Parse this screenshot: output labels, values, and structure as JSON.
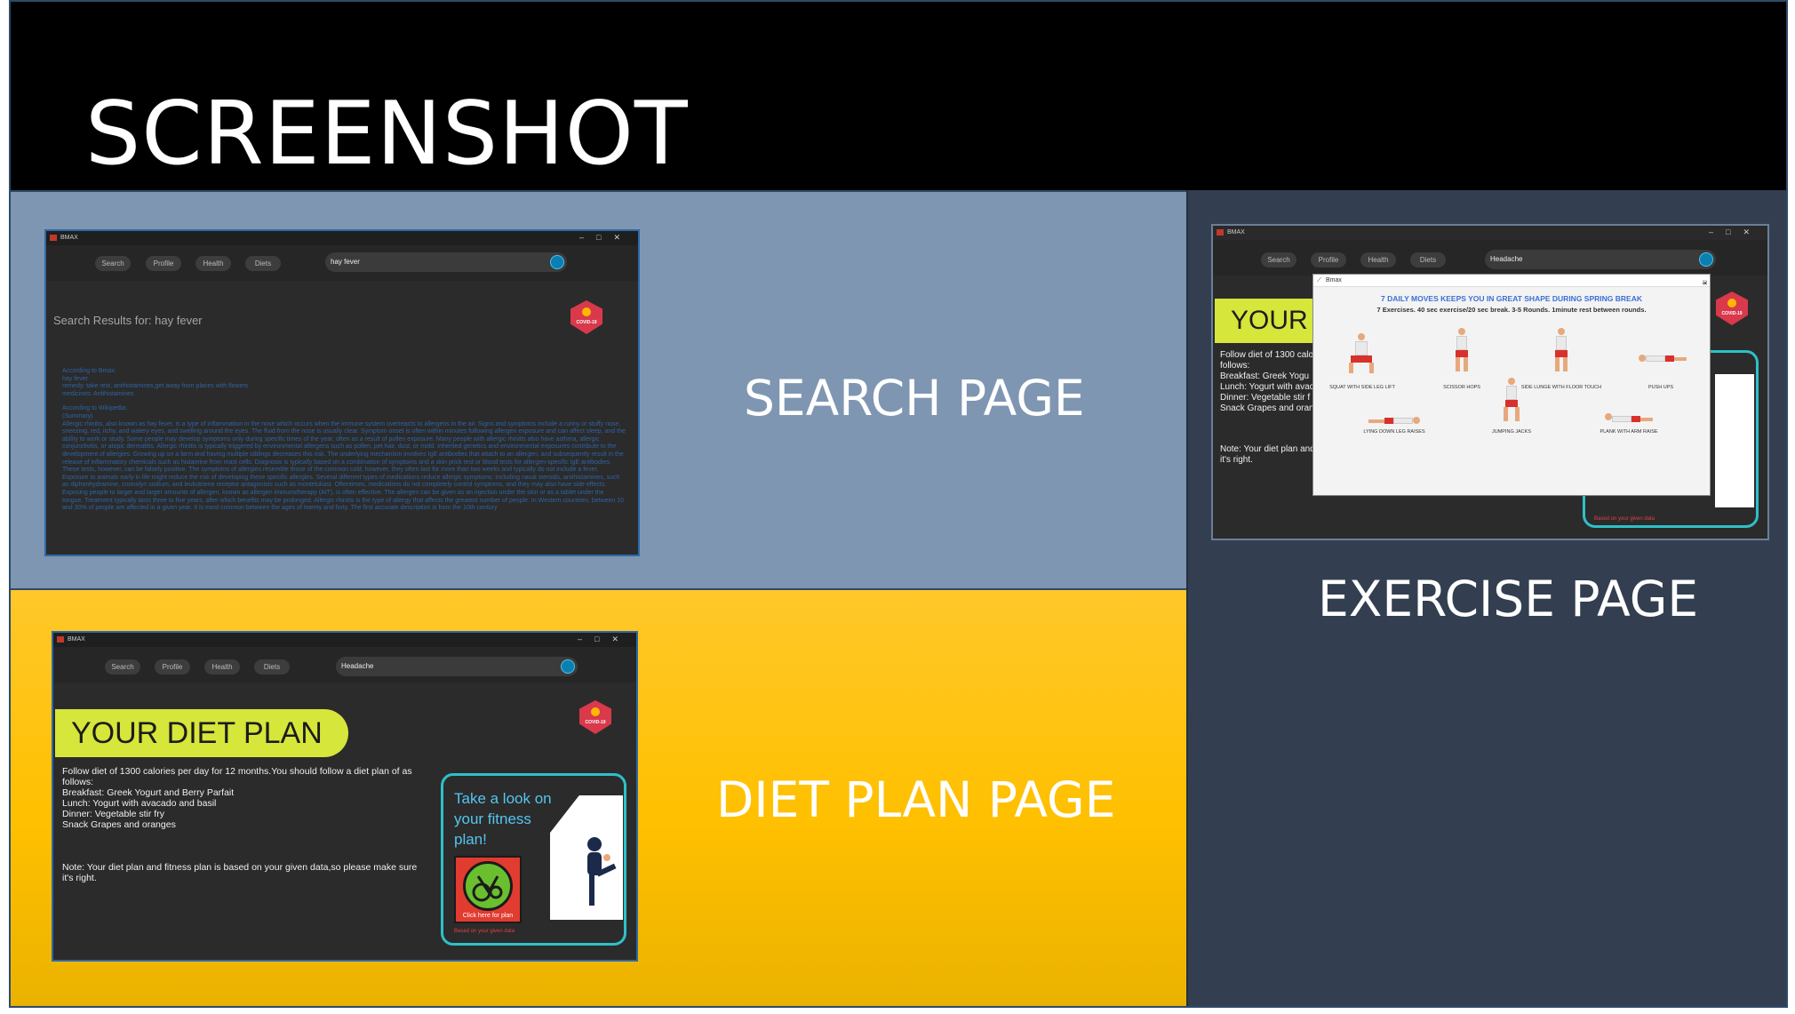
{
  "slide": {
    "title": "SCREENSHOT",
    "captions": {
      "search": "SEARCH PAGE",
      "diet": "DIET PLAN PAGE",
      "exercise": "EXERCISE PAGE"
    },
    "colors": {
      "header": "#000000",
      "search_panel": "#7f96b2",
      "diet_panel": "#ffc000",
      "exercise_panel": "#333f50"
    }
  },
  "app": {
    "window_title": "BMAX",
    "nav": [
      "Search",
      "Profile",
      "Health",
      "Diets"
    ],
    "badge_text": "COVID-19",
    "window_controls": [
      "–",
      "□",
      "✕"
    ]
  },
  "search_page": {
    "query": "hay fever",
    "results_heading": "Search Results for: hay fever",
    "bmax_block": [
      "According to Bmax:",
      "hay fever",
      "remedy: take rest, antihistamines,get away from places with flowers",
      "medicines: Antihistamines"
    ],
    "wiki_block_heading": "According to Wikipedia:",
    "wiki_block_sub": "(Summary)",
    "wiki_text": "Allergic rhinitis, also known as hay fever, is a type of inflammation in the nose which occurs when the immune system overreacts to allergens in the air. Signs and symptoms include a runny or stuffy nose, sneezing, red, itchy, and watery eyes, and swelling around the eyes. The fluid from the nose is usually clear. Symptom onset is often within minutes following allergen exposure and can affect sleep, and the ability to work or study. Some people may develop symptoms only during specific times of the year, often as a result of pollen exposure. Many people with allergic rhinitis also have asthma, allergic conjunctivitis, or atopic dermatitis. Allergic rhinitis is typically triggered by environmental allergens such as pollen, pet hair, dust, or mold. Inherited genetics and environmental exposures contribute to the development of allergies. Growing up on a farm and having multiple siblings decreases this risk. The underlying mechanism involves IgE antibodies that attach to an allergen, and subsequently result in the release of inflammatory chemicals such as histamine from mast cells. Diagnosis is typically based on a combination of symptoms and a skin prick test or blood tests for allergen-specific IgE antibodies. These tests, however, can be falsely positive. The symptoms of allergies resemble those of the common cold; however, they often last for more than two weeks and typically do not include a fever. Exposure to animals early in life might reduce the risk of developing these specific allergies. Several different types of medications reduce allergic symptoms: including nasal steroids, antihistamines, such as diphenhydramine, cromolyn sodium, and leukotriene receptor antagonists such as montelukast. Oftentimes, medications do not completely control symptoms, and they may also have side effects. Exposing people to larger and larger amounts of allergen, known as allergen immunotherapy (AIT), is often effective. The allergen can be given as an injection under the skin or as a tablet under the tongue. Treatment typically lasts three to five years, after which benefits may be prolonged. Allergic rhinitis is the type of allergy that affects the greatest number of people. In Western countries, between 10 and 30% of people are affected in a given year. It is most common between the ages of twenty and forty. The first accurate description is from the 10th century"
  },
  "diet_page": {
    "query": "Headache",
    "plan_title": "YOUR DIET PLAN",
    "plan_lines": [
      "Follow diet of 1300 calories per day for 12 months.You should follow a diet plan of as follows:",
      "Breakfast: Greek Yogurt and Berry Parfait",
      "Lunch: Yogurt with avacado and basil",
      "Dinner: Vegetable stir fry",
      "Snack Grapes and oranges"
    ],
    "note": "Note: Your diet plan and fitness plan is based on your given data,so please make sure it's right.",
    "fitness_card": {
      "title": "Take a look on your fitness plan!",
      "button": "Click here for plan",
      "footer": "Based on your given data"
    }
  },
  "exercise_page": {
    "query": "Headache",
    "plan_title": "YOUR",
    "plan_lines": [
      "Follow diet of 1300 calo",
      "follows:",
      "Breakfast: Greek Yogu",
      "Lunch: Yogurt with avac",
      "Dinner: Vegetable stir f",
      "Snack Grapes and oran"
    ],
    "note_lines": [
      "Note: Your diet plan and",
      "it's right."
    ],
    "card_footer": "Based on your given data",
    "popup": {
      "window_title": "Bmax",
      "title": "7 DAILY MOVES KEEPS YOU IN GREAT SHAPE DURING SPRING BREAK",
      "subtitle": "7 Exercises. 40 sec exercise/20 sec break. 3-5 Rounds. 1minute rest between rounds.",
      "exercises": [
        "SQUAT WITH SIDE LEG LIFT",
        "SCISSOR HOPS",
        "SIDE LUNGE WITH FLOOR TOUCH",
        "PUSH UPS",
        "LYING DOWN LEG RAISES",
        "JUMPING JACKS",
        "PLANK WITH ARM RAISE"
      ]
    }
  }
}
